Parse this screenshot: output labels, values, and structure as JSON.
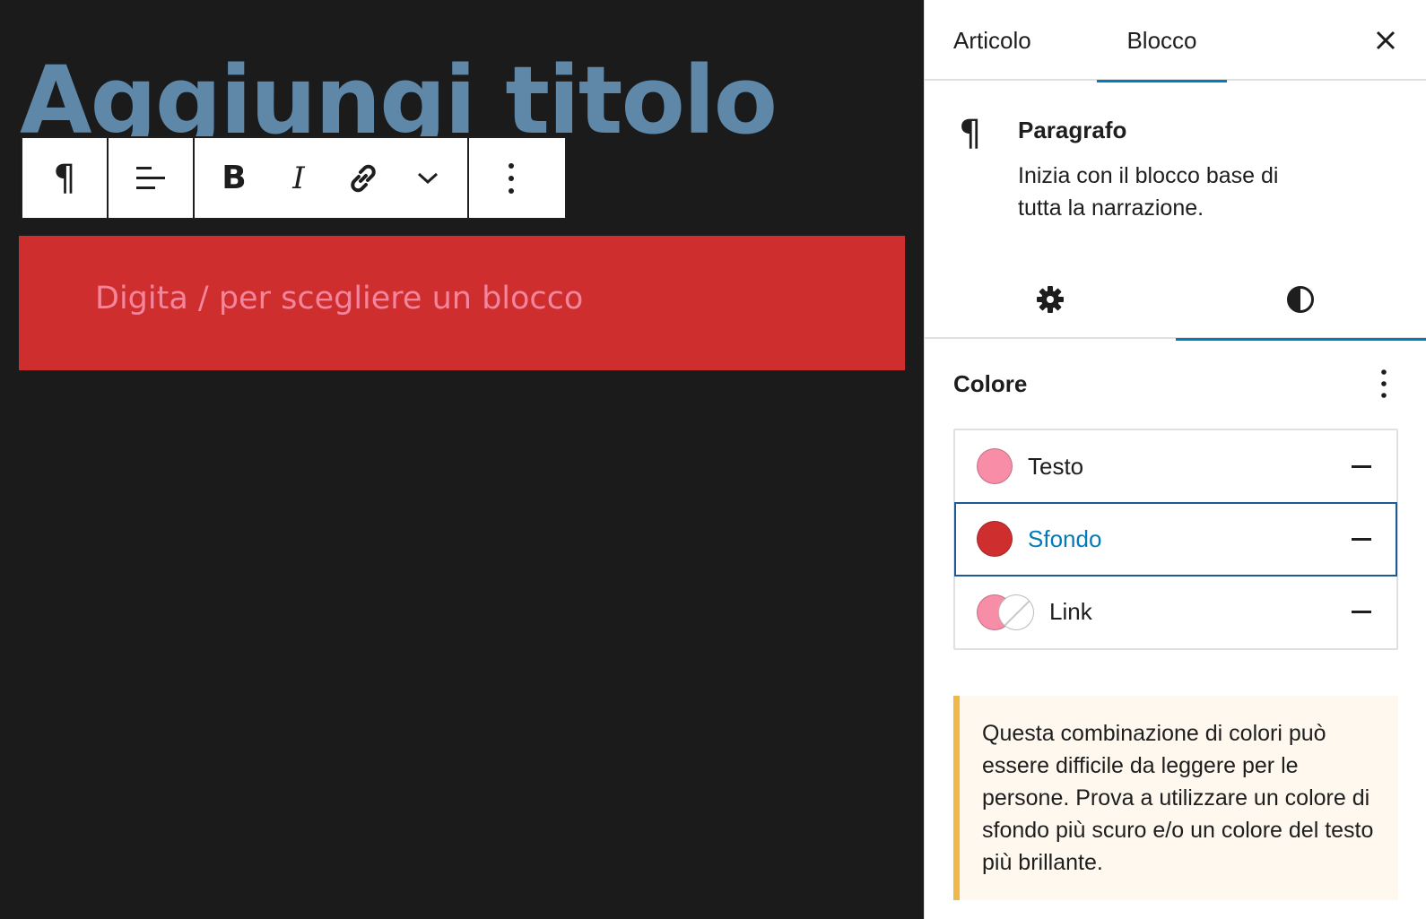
{
  "editor": {
    "post_title_placeholder": "Aggiungi titolo",
    "paragraph_placeholder": "Digita / per scegliere un blocco",
    "paragraph_background": "#cf2e2e",
    "paragraph_text_color": "#f78da7"
  },
  "block_toolbar": {
    "items": [
      {
        "name": "paragraph-block-type",
        "icon": "pilcrow-icon"
      },
      {
        "name": "align",
        "icon": "align-left-icon"
      },
      {
        "name": "bold",
        "label": "B"
      },
      {
        "name": "italic",
        "label": "I"
      },
      {
        "name": "link",
        "icon": "link-icon"
      },
      {
        "name": "more-formats",
        "icon": "chevron-down-icon"
      },
      {
        "name": "options",
        "icon": "more-vertical-icon"
      }
    ],
    "pilcrow": "¶"
  },
  "sidebar": {
    "tabs": [
      {
        "label": "Articolo",
        "active": false
      },
      {
        "label": "Blocco",
        "active": true
      }
    ],
    "block_card": {
      "icon": "¶",
      "title": "Paragrafo",
      "description": "Inizia con il blocco base di tutta la narrazione."
    },
    "sub_tabs": [
      {
        "icon": "gear-icon",
        "active": false
      },
      {
        "icon": "contrast-icon",
        "active": true
      }
    ],
    "color_panel": {
      "title": "Colore",
      "items": [
        {
          "label": "Testo",
          "swatch": "#f78da7",
          "selected": false
        },
        {
          "label": "Sfondo",
          "swatch": "#cf2e2e",
          "selected": true
        },
        {
          "label": "Link",
          "swatch": "#f78da7",
          "selected": false
        }
      ]
    },
    "contrast_notice": "Questa combinazione di colori può essere difficile da leggere per le persone. Prova a utilizzare un colore di sfondo più scuro e/o un colore del testo più brillante."
  },
  "colors": {
    "accent": "#007cba",
    "title": "#5e87a8",
    "canvas": "#1b1b1c",
    "notice_border": "#f0b849"
  }
}
